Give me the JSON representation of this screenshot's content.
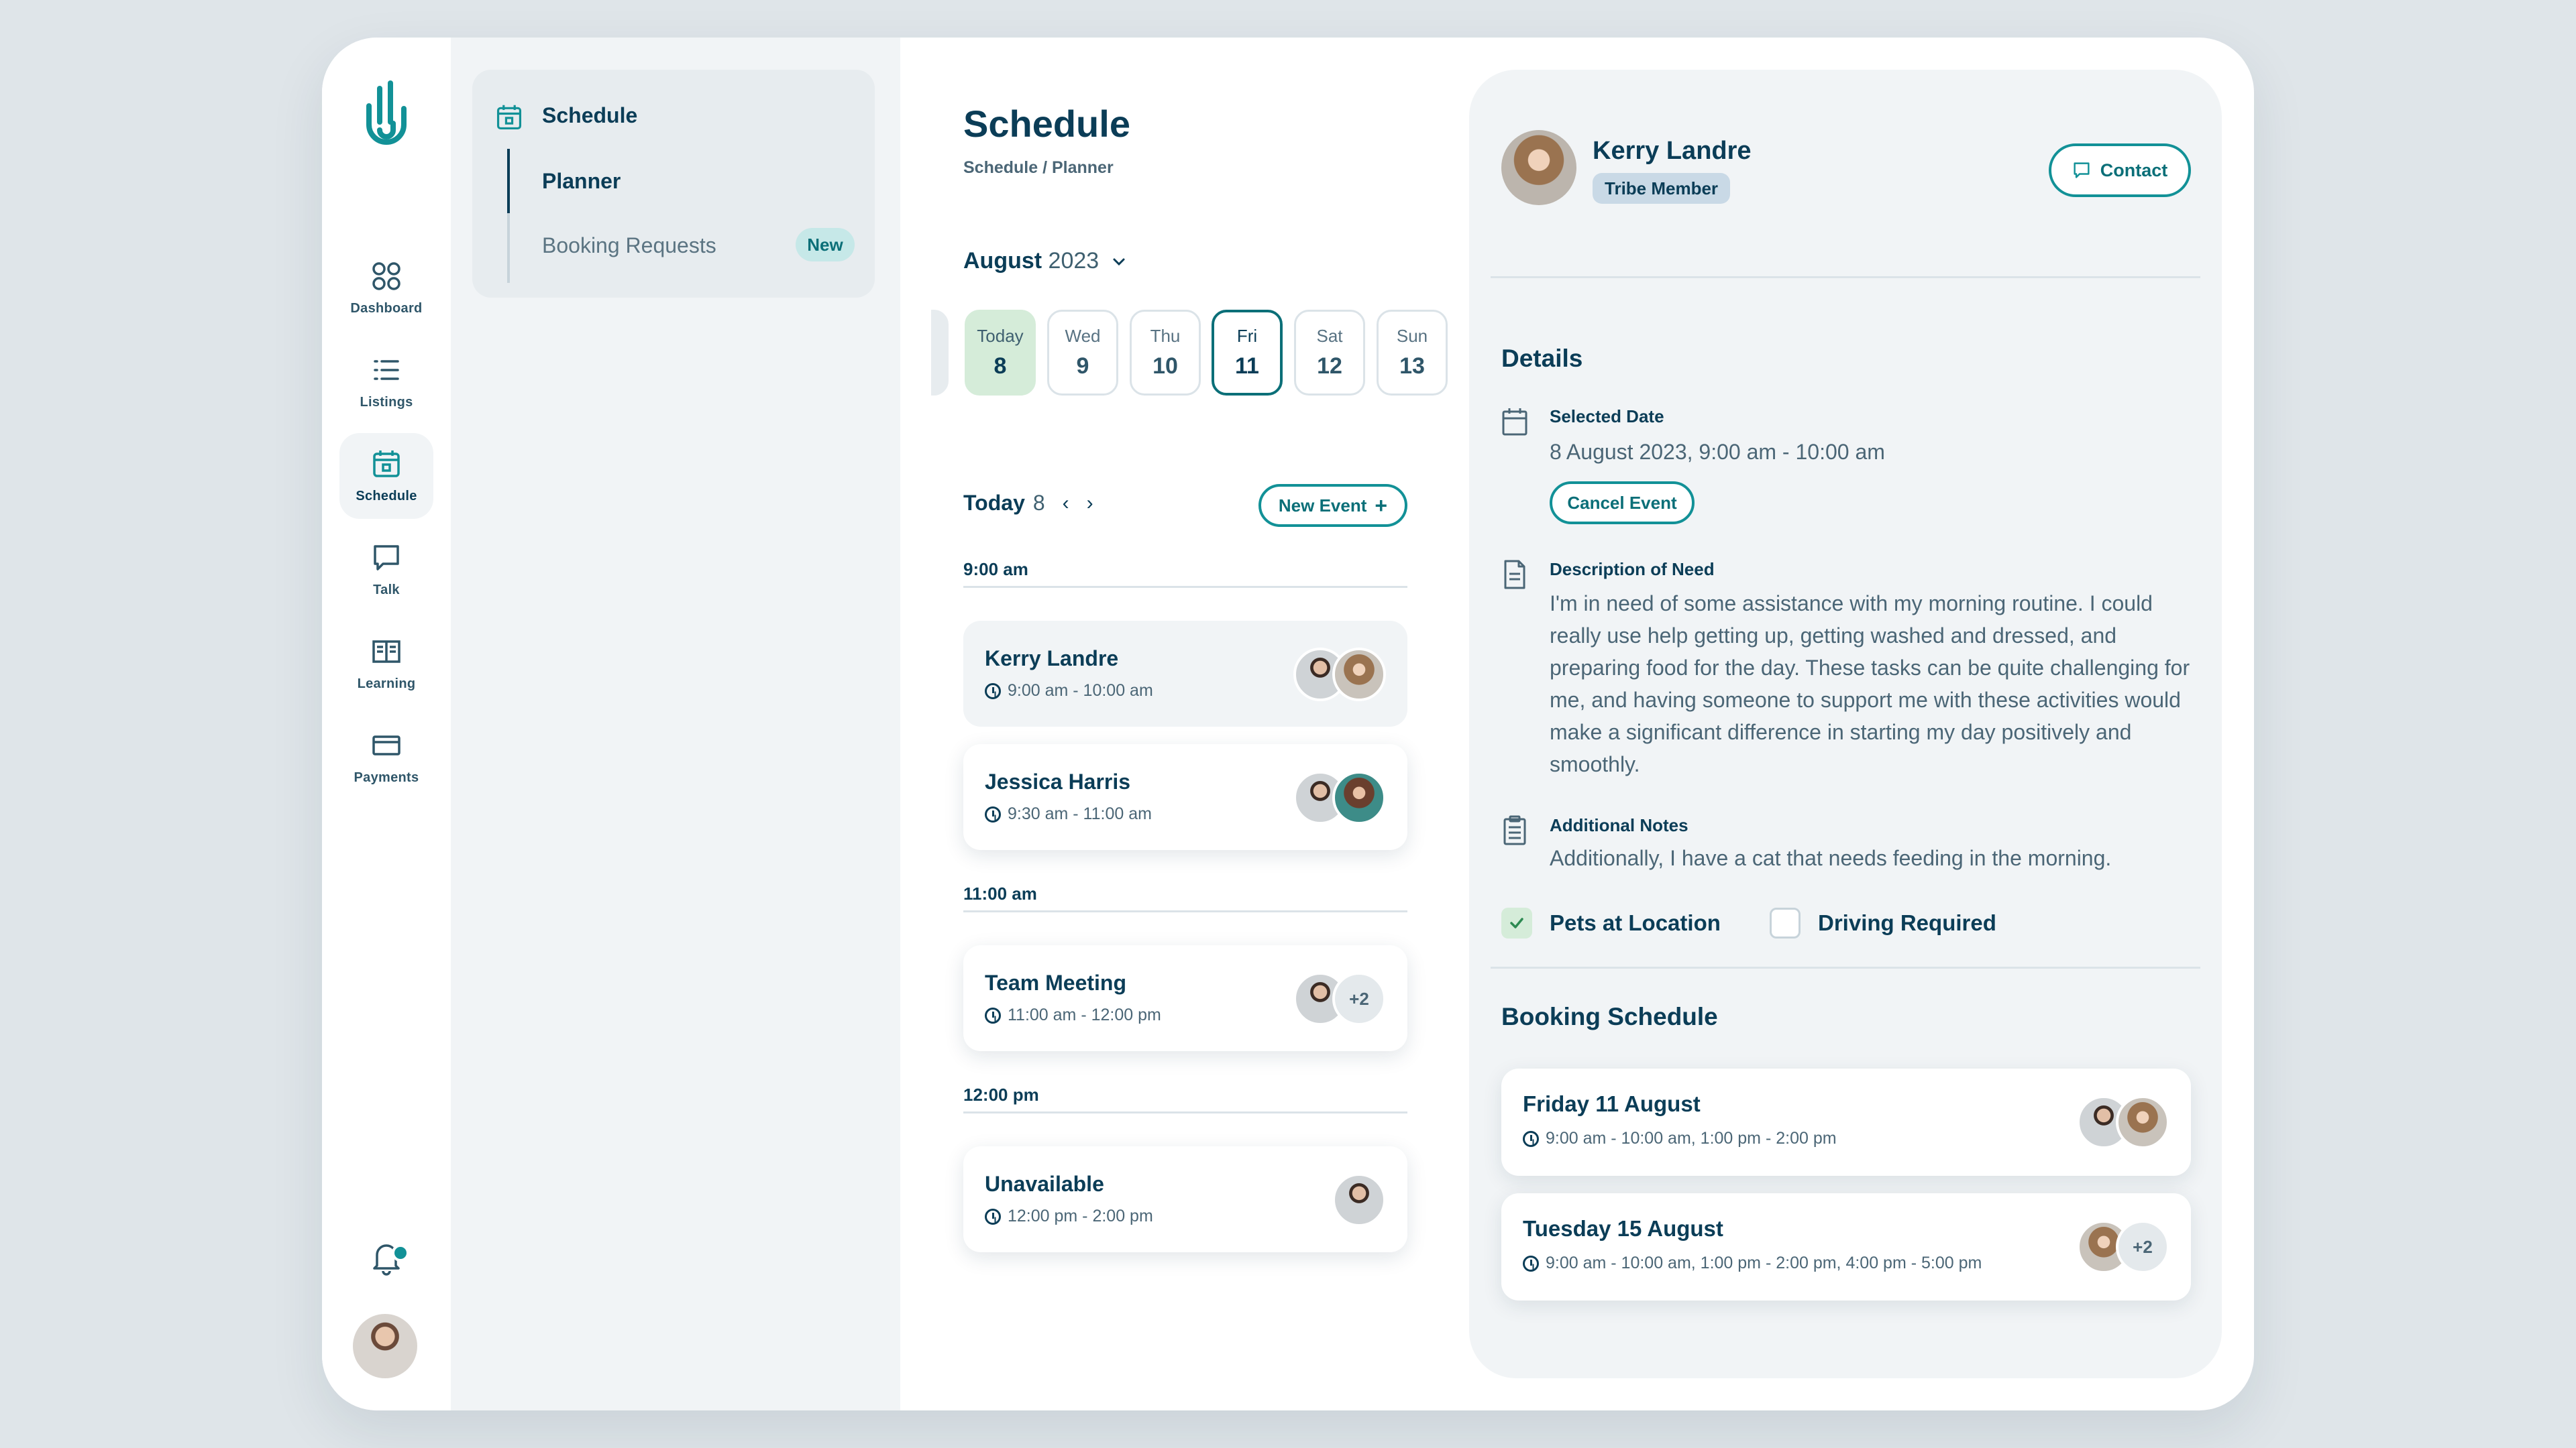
{
  "nav": {
    "items": [
      {
        "label": "Dashboard",
        "icon": "dashboard-icon"
      },
      {
        "label": "Listings",
        "icon": "list-icon"
      },
      {
        "label": "Schedule",
        "icon": "calendar-icon"
      },
      {
        "label": "Talk",
        "icon": "chat-icon"
      },
      {
        "label": "Learning",
        "icon": "book-icon"
      },
      {
        "label": "Payments",
        "icon": "card-icon"
      }
    ],
    "active": "Schedule"
  },
  "subnav": {
    "title": "Schedule",
    "items": [
      {
        "label": "Planner",
        "active": true
      },
      {
        "label": "Booking Requests",
        "badge": "New"
      }
    ]
  },
  "header": {
    "title": "Schedule",
    "breadcrumb": "Schedule / Planner"
  },
  "calendar": {
    "month": "August",
    "year": "2023",
    "days": [
      {
        "name": "Today",
        "num": "8",
        "state": "today"
      },
      {
        "name": "Wed",
        "num": "9"
      },
      {
        "name": "Thu",
        "num": "10"
      },
      {
        "name": "Fri",
        "num": "11",
        "state": "selected"
      },
      {
        "name": "Sat",
        "num": "12"
      },
      {
        "name": "Sun",
        "num": "13"
      }
    ]
  },
  "day_view": {
    "label": "Today",
    "num": "8",
    "new_event": "New Event",
    "slots": [
      {
        "time": "9:00 am"
      },
      {
        "time": "11:00 am"
      },
      {
        "time": "12:00 pm"
      }
    ],
    "events": [
      {
        "name": "Kerry Landre",
        "time": "9:00 am - 10:00 am",
        "avatars": [
          "m",
          "w"
        ],
        "muted": true
      },
      {
        "name": "Jessica Harris",
        "time": "9:30 am - 11:00 am",
        "avatars": [
          "m",
          "w2"
        ]
      },
      {
        "name": "Team Meeting",
        "time": "11:00 am - 12:00 pm",
        "avatars": [
          "m"
        ],
        "more": "+2"
      },
      {
        "name": "Unavailable",
        "time": "12:00 pm - 2:00 pm",
        "avatars": [
          "m"
        ]
      }
    ]
  },
  "profile": {
    "name": "Kerry Landre",
    "role": "Tribe Member",
    "contact": "Contact"
  },
  "details": {
    "title": "Details",
    "selected_date_label": "Selected Date",
    "selected_date": "8 August 2023, 9:00 am - 10:00 am",
    "cancel": "Cancel Event",
    "need_label": "Description of Need",
    "need": "I'm in need of some assistance with my morning routine. I could really use help getting up, getting washed and dressed, and preparing food for the day. These tasks can be quite challenging for me, and having someone to support me with these activities would make a significant difference in starting my day positively and smoothly.",
    "notes_label": "Additional Notes",
    "notes": "Additionally, I have a cat that needs feeding in the morning.",
    "pets_label": "Pets at Location",
    "pets_checked": true,
    "driving_label": "Driving Required",
    "driving_checked": false
  },
  "booking": {
    "title": "Booking Schedule",
    "items": [
      {
        "day": "Friday 11 August",
        "times": "9:00 am - 10:00 am, 1:00 pm - 2:00 pm",
        "avatars": [
          "m",
          "w"
        ]
      },
      {
        "day": "Tuesday 15 August",
        "times": "9:00 am - 10:00 am, 1:00 pm - 2:00 pm, 4:00 pm - 5:00 pm",
        "avatars": [
          "w"
        ],
        "more": "+2"
      }
    ]
  },
  "colors": {
    "accent": "#129197",
    "navy": "#0b3d57",
    "today_green": "#d5ecd9",
    "panel": "#f1f4f6"
  }
}
